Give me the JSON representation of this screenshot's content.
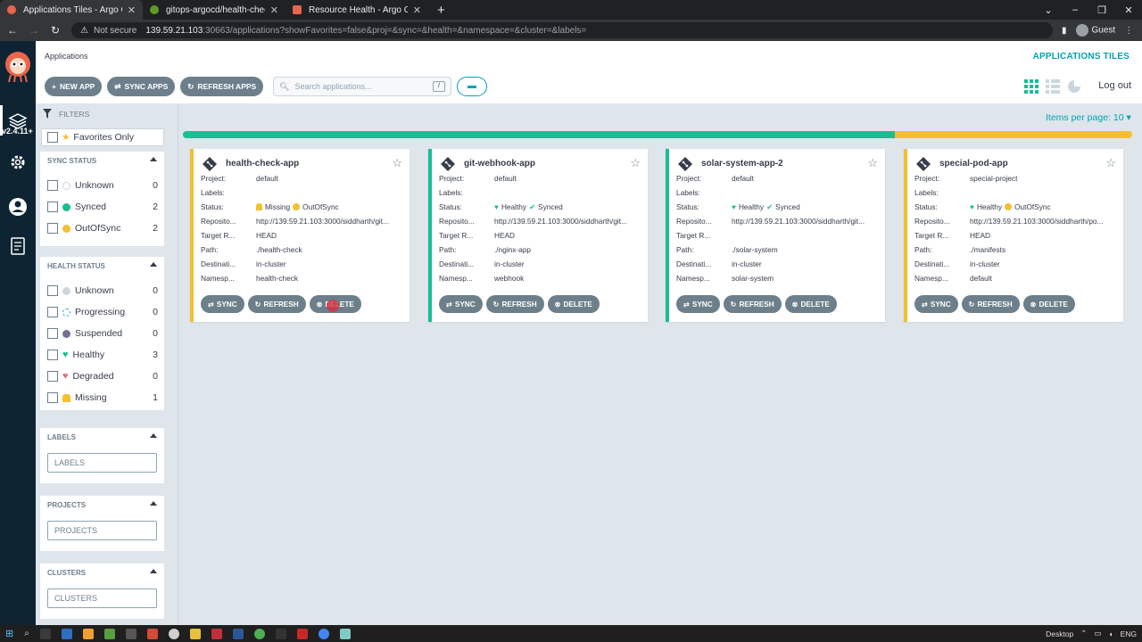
{
  "browser": {
    "tabs": [
      {
        "title": "Applications Tiles - Argo CD",
        "active": true,
        "icon": "argo-icon",
        "color": "#e9654b"
      },
      {
        "title": "gitops-argocd/health-check at m",
        "active": false,
        "icon": "gitea-icon",
        "color": "#609926"
      },
      {
        "title": "Resource Health - Argo CD - De",
        "active": false,
        "icon": "argo-docs-icon",
        "color": "#e9654b"
      }
    ],
    "address": {
      "security": "Not secure",
      "host": "139.59.21.103",
      "rest": ":30663/applications?showFavorites=false&proj=&sync=&health=&namespace=&cluster=&labels="
    },
    "profile": "Guest"
  },
  "app": {
    "version": "v2.4.11+",
    "breadcrumb": "Applications",
    "page_title": "APPLICATIONS TILES",
    "logout": "Log out",
    "actions": [
      {
        "label": "NEW APP",
        "icon": "plus-icon"
      },
      {
        "label": "SYNC APPS",
        "icon": "sync-icon"
      },
      {
        "label": "REFRESH APPS",
        "icon": "refresh-icon"
      }
    ],
    "search_placeholder": "Search applications...",
    "search_shortcut": "/",
    "items_per_page": "Items per page: 10"
  },
  "filters": {
    "heading": "FILTERS",
    "favorites": "Favorites Only",
    "sync_status": {
      "title": "SYNC STATUS",
      "items": [
        {
          "label": "Unknown",
          "count": "0",
          "color": "#ccd6dd"
        },
        {
          "label": "Synced",
          "count": "2",
          "color": "#18be94"
        },
        {
          "label": "OutOfSync",
          "count": "2",
          "color": "#f4c030"
        }
      ]
    },
    "health_status": {
      "title": "HEALTH STATUS",
      "items": [
        {
          "label": "Unknown",
          "count": "0",
          "color": "#ccd6dd"
        },
        {
          "label": "Progressing",
          "count": "0",
          "color": "#0dadea"
        },
        {
          "label": "Suspended",
          "count": "0",
          "color": "#766f94"
        },
        {
          "label": "Healthy",
          "count": "3",
          "color": "#18be94"
        },
        {
          "label": "Degraded",
          "count": "0",
          "color": "#e96d76"
        },
        {
          "label": "Missing",
          "count": "1",
          "color": "#f4c030"
        }
      ]
    },
    "labels": {
      "title": "LABELS",
      "placeholder": "LABELS"
    },
    "projects": {
      "title": "PROJECTS",
      "placeholder": "PROJECTS"
    },
    "clusters": {
      "title": "CLUSTERS",
      "placeholder": "CLUSTERS"
    }
  },
  "summary": {
    "synced_fraction": 0.75
  },
  "field_labels": {
    "project": "Project:",
    "labels": "Labels:",
    "status": "Status:",
    "repo": "Reposito...",
    "target": "Target R...",
    "path": "Path:",
    "dest": "Destinati...",
    "ns": "Namesp..."
  },
  "card_buttons": {
    "sync": "SYNC",
    "refresh": "REFRESH",
    "delete": "DELETE"
  },
  "applications": [
    {
      "name": "health-check-app",
      "project": "default",
      "labels": "",
      "health": "Missing",
      "health_color": "#f4c030",
      "sync": "OutOfSync",
      "sync_color": "#f4c030",
      "repo": "http://139.59.21.103:3000/siddharth/git...",
      "target": "HEAD",
      "path": "./health-check",
      "destination": "in-cluster",
      "namespace": "health-check"
    },
    {
      "name": "git-webhook-app",
      "project": "default",
      "labels": "",
      "health": "Healthy",
      "health_color": "#18be94",
      "sync": "Synced",
      "sync_color": "#18be94",
      "repo": "http://139.59.21.103:3000/siddharth/git...",
      "target": "HEAD",
      "path": "./nginx-app",
      "destination": "in-cluster",
      "namespace": "webhook"
    },
    {
      "name": "solar-system-app-2",
      "project": "default",
      "labels": "",
      "health": "Healthy",
      "health_color": "#18be94",
      "sync": "Synced",
      "sync_color": "#18be94",
      "repo": "http://139.59.21.103:3000/siddharth/git...",
      "target": "",
      "path": "./solar-system",
      "destination": "in-cluster",
      "namespace": "solar-system"
    },
    {
      "name": "special-pod-app",
      "project": "special-project",
      "labels": "",
      "health": "Healthy",
      "health_color": "#18be94",
      "sync": "OutOfSync",
      "sync_color": "#f4c030",
      "repo": "http://139.59.21.103:3000/siddharth/po...",
      "target": "HEAD",
      "path": "./manifests",
      "destination": "in-cluster",
      "namespace": "default"
    }
  ],
  "taskbar": {
    "desktop_label": "Desktop",
    "lang": "ENG"
  }
}
